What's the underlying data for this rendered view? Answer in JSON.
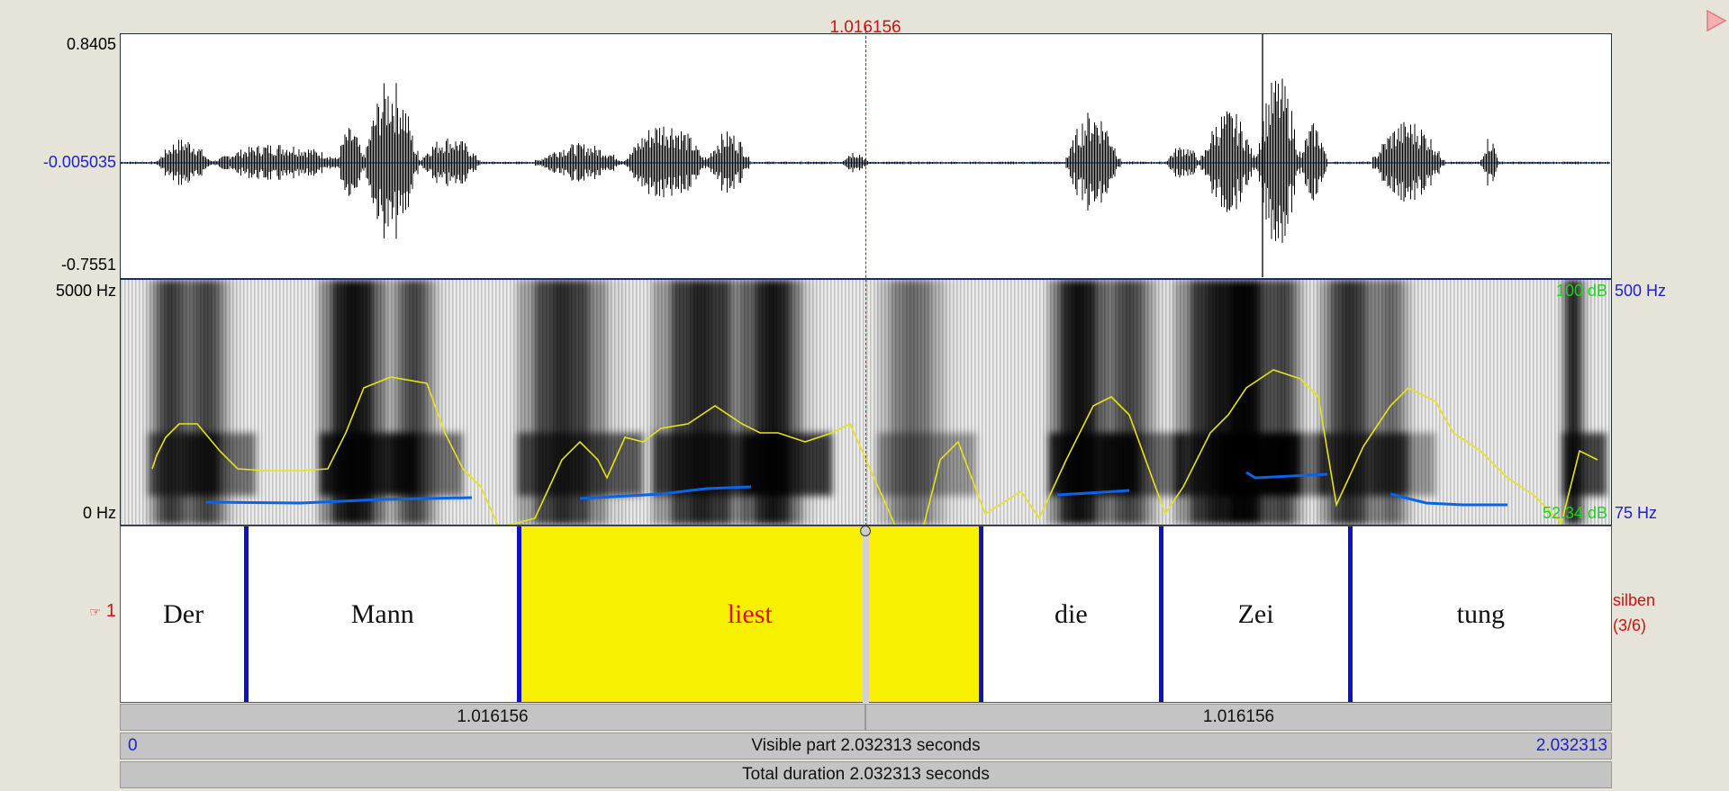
{
  "cursor": {
    "time_label": "1.016156",
    "time_s": 1.016156
  },
  "waveform": {
    "max_label": "0.8405",
    "zero_label": "-0.005035",
    "min_label": "-0.7551"
  },
  "spectrogram": {
    "freq_top_label": "5000 Hz",
    "freq_bottom_label": "0 Hz",
    "intensity_top_label": "100 dB",
    "intensity_bottom_label": "52.34 dB",
    "pitch_top_label": "500 Hz",
    "pitch_bottom_label": "75 Hz"
  },
  "tier": {
    "number_label": "1",
    "name": "silben",
    "count_label": "(3/6)",
    "intervals": [
      {
        "text": "Der",
        "start_s": 0.0,
        "end_s": 0.171
      },
      {
        "text": "Mann",
        "start_s": 0.171,
        "end_s": 0.543
      },
      {
        "text": "liest",
        "start_s": 0.543,
        "end_s": 1.173,
        "selected": true
      },
      {
        "text": "die",
        "start_s": 1.173,
        "end_s": 1.419
      },
      {
        "text": "Zei",
        "start_s": 1.419,
        "end_s": 1.677
      },
      {
        "text": "tung",
        "start_s": 1.677,
        "end_s": 2.032313
      }
    ]
  },
  "time_bars": {
    "left_segment_label": "1.016156",
    "right_segment_label": "1.016156",
    "visible_start_label": "0",
    "visible_end_label": "2.032313",
    "visible_part_label": "Visible part 2.032313 seconds",
    "total_duration_label": "Total duration 2.032313 seconds"
  },
  "colors": {
    "selection": "#f7f000",
    "boundary": "#1010c0",
    "pitch": "#0a64e6",
    "intensity": "#e6e600",
    "cursor": "#d01010"
  }
}
